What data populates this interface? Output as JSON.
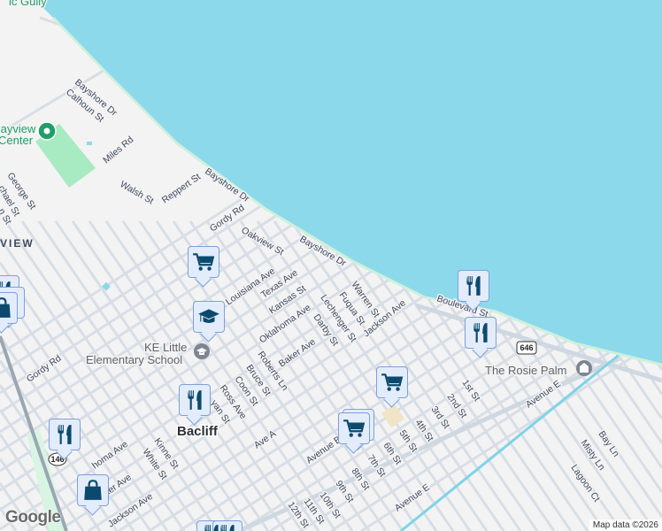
{
  "map": {
    "water_label_partial": "ic Gully",
    "park": {
      "name_line1": "Bayview",
      "name_line2": "Center"
    },
    "area_label": "VIEW",
    "town_label": "Bacliff",
    "school": {
      "line1": "KE Little",
      "line2": "Elementary School"
    },
    "poi_rosie_palm": "The Rosie Palm",
    "highways": [
      "146",
      "646"
    ],
    "streets": {
      "bayshore_dr": "Bayshore Dr",
      "calhoun_st": "Calhoun St",
      "miles_rd": "Miles Rd",
      "walsh_st": "Walsh St",
      "reppert_st": "Reppert St",
      "george_st": "George St",
      "michael_st": "chael St",
      "n_st": "n St",
      "gordy_rd": "Gordy Rd",
      "oakview_st": "Oakview St",
      "louisiana_ave": "Louisiana Ave",
      "texas_ave": "Texas Ave",
      "kansas_st": "Kansas St",
      "oklahoma_ave": "Oklahoma Ave",
      "warren_st": "Warren St",
      "fuqua_st": "Fuqua St",
      "lechenger_st": "Lechenger St",
      "darby_st": "Darby St",
      "jackson_ave": "Jackson Ave",
      "baker_ave": "Baker Ave",
      "roberts_ln": "Roberts Ln",
      "bruce_st": "Bruce St",
      "coon_st": "Coon St",
      "ross_ave": "Ross Ave",
      "ryan_st": "yan St",
      "boulevard_st": "Boulevard St",
      "ave_a": "Ave A",
      "avenue_b": "Avenue B",
      "avenue_e": "Avenue E",
      "st1": "1st St",
      "st2": "2nd St",
      "st3": "3rd St",
      "st4": "4th St",
      "st5": "5th St",
      "st6": "6th St",
      "st7": "7th St",
      "st8": "8th St",
      "st9": "9th St",
      "st10": "10th St",
      "st11": "11th St",
      "st12": "12th St",
      "bay_ln": "Bay Ln",
      "misty_ln": "Misty Ln",
      "lagoon_ct": "Lagoon Ct",
      "kinne_st": "Kinne St",
      "white_st": "White St",
      "oklahoma_ave_w": "homa Ave",
      "baker_ave_w": "Baker Ave",
      "jackson_ave_w": "Jackson Ave"
    },
    "colors": {
      "water": "#8dd9ec",
      "land": "#f4f3f4",
      "park": "#a8eac2",
      "road": "#d3dbe2",
      "highway": "#9aa6b2",
      "marker_icon": "#0b4a6e"
    }
  },
  "attribution": "Map data ©2026",
  "logo": "Google"
}
